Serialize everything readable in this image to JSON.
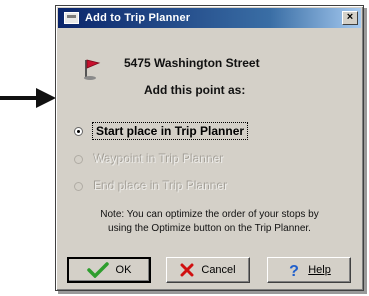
{
  "dialog": {
    "title": "Add to Trip Planner",
    "close_label": "×",
    "address": "5475 Washington Street",
    "prompt": "Add this point as:"
  },
  "options": [
    {
      "label": "Start place in Trip Planner",
      "selected": true,
      "enabled": true
    },
    {
      "label": "Waypoint in Trip Planner",
      "selected": false,
      "enabled": false
    },
    {
      "label": "End place in Trip Planner",
      "selected": false,
      "enabled": false
    }
  ],
  "note": {
    "line1": "Note: You can optimize the order of your stops by",
    "line2": "using the Optimize button on the Trip Planner."
  },
  "buttons": {
    "ok": "OK",
    "cancel": "Cancel",
    "help": "Help"
  },
  "icons": {
    "flag": "flag-pin-icon",
    "ok": "green-check-icon",
    "cancel": "red-x-icon",
    "help": "question-mark-icon"
  },
  "colors": {
    "titlebar_start": "#0a246a",
    "titlebar_end": "#a6caf0",
    "dialog_bg": "#d4d0c8",
    "flag_red": "#c8102e",
    "ok_green": "#2e9e2e",
    "cancel_red": "#d01010",
    "help_blue": "#1f5fcc"
  }
}
